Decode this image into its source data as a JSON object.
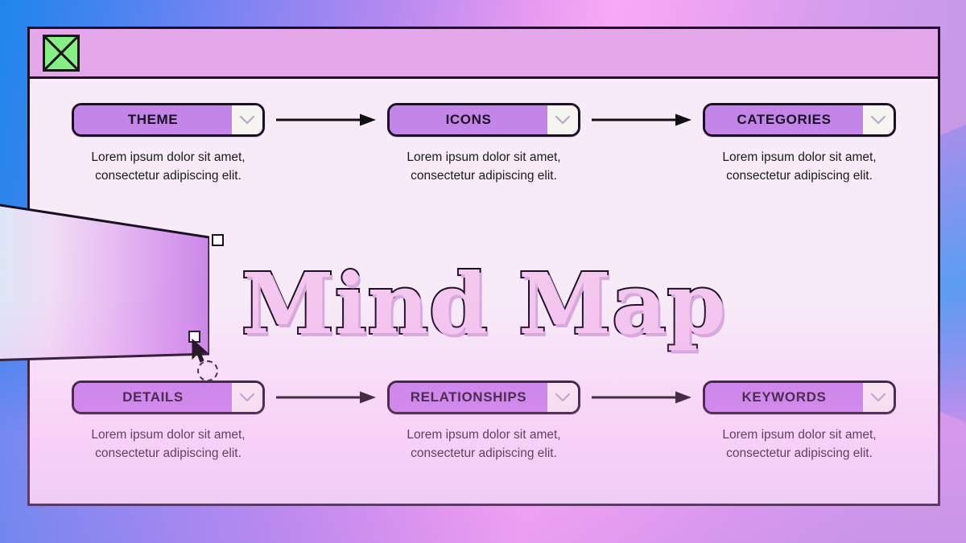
{
  "slide": {
    "title": "Mind Map",
    "header": {
      "logo_icon": "image-placeholder-icon"
    },
    "colors": {
      "node_fill": "#c485e8",
      "panel_bg": "#f7ebf8",
      "header_bg": "#e3a7ea",
      "outline": "#1b0f24",
      "title_fill": "#f4c7ef",
      "logo_green": "#85ef85"
    }
  },
  "nodes": {
    "top": [
      {
        "label": "THEME",
        "caret_icon": "chevron-down-icon",
        "desc_line1": "Lorem ipsum dolor sit amet,",
        "desc_line2": "consectetur adipiscing elit."
      },
      {
        "label": "ICONS",
        "caret_icon": "chevron-down-icon",
        "desc_line1": "Lorem ipsum dolor sit amet,",
        "desc_line2": "consectetur adipiscing elit."
      },
      {
        "label": "CATEGORIES",
        "caret_icon": "chevron-down-icon",
        "desc_line1": "Lorem ipsum dolor sit amet,",
        "desc_line2": "consectetur adipiscing elit."
      }
    ],
    "bottom": [
      {
        "label": "DETAILS",
        "caret_icon": "chevron-down-icon",
        "desc_line1": "Lorem ipsum dolor sit amet,",
        "desc_line2": "consectetur adipiscing elit."
      },
      {
        "label": "RELATIONSHIPS",
        "caret_icon": "chevron-down-icon",
        "desc_line1": "Lorem ipsum dolor sit amet,",
        "desc_line2": "consectetur adipiscing elit."
      },
      {
        "label": "KEYWORDS",
        "caret_icon": "chevron-down-icon",
        "desc_line1": "Lorem ipsum dolor sit amet,",
        "desc_line2": "consectetur adipiscing elit."
      }
    ]
  },
  "connectors": {
    "icon": "arrow-right-icon",
    "count": 4
  },
  "editor": {
    "selection_handles": 2,
    "cursor_icon": "arrow-cursor",
    "cursor_ring_icon": "dashed-circle-icon"
  },
  "decorations": {
    "left_shape": "gradient-quadrilateral",
    "right_shape": "gradient-hexagon"
  }
}
